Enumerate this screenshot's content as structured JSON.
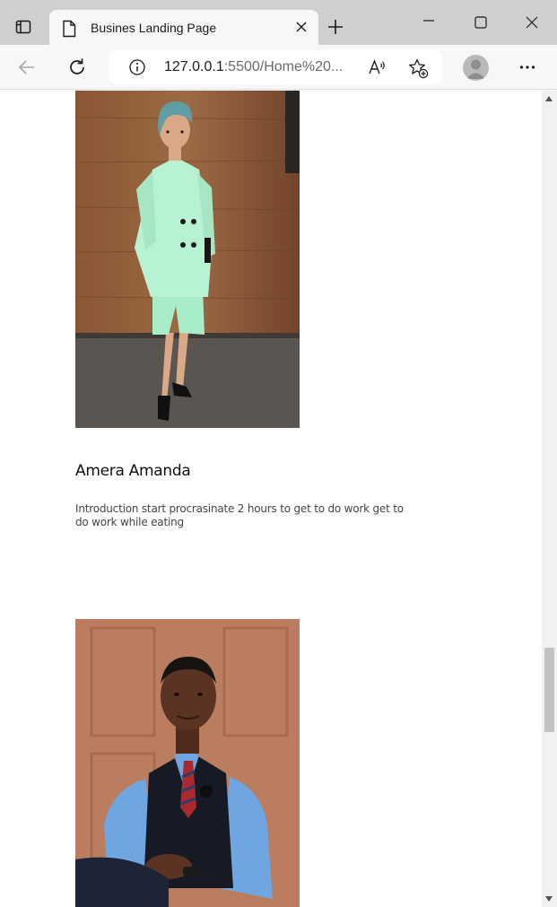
{
  "browser": {
    "tab_title": "Busines Landing Page",
    "url_host": "127.0.0.1",
    "url_rest": ":5500/Home%20..."
  },
  "content": {
    "profile_name": "Amera Amanda",
    "profile_intro": "Introduction start procrasinate 2 hours to get to do work get to do work while eating"
  },
  "icons": {
    "tab_actions": "tab-actions-icon",
    "page": "page-icon",
    "close": "close-icon",
    "new_tab": "plus-icon",
    "minimize": "minimize-icon",
    "maximize": "maximize-icon",
    "window_close": "close-icon",
    "back": "back-arrow-icon",
    "refresh": "refresh-icon",
    "info": "info-icon",
    "read_aloud": "read-aloud-icon",
    "add_favorite": "star-add-icon",
    "profile": "avatar-icon",
    "more": "ellipsis-icon"
  },
  "colors": {
    "titlebar": "#cfcfcf",
    "toolbar": "#f7f7f7",
    "page_bg": "#ffffff"
  }
}
